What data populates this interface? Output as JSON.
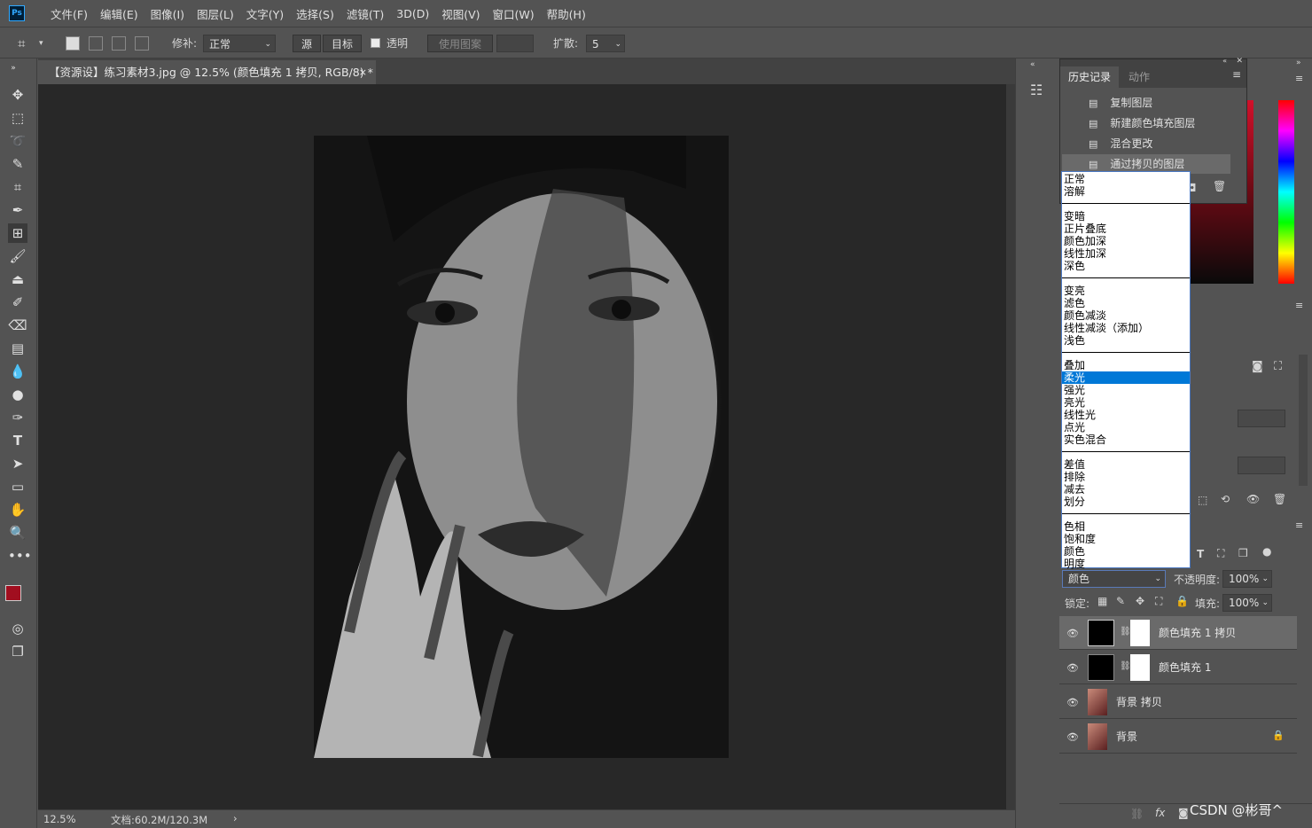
{
  "app": {
    "logo": "Ps"
  },
  "menu": [
    "文件(F)",
    "编辑(E)",
    "图像(I)",
    "图层(L)",
    "文字(Y)",
    "选择(S)",
    "滤镜(T)",
    "3D(D)",
    "视图(V)",
    "窗口(W)",
    "帮助(H)"
  ],
  "options": {
    "patch_label": "修补:",
    "patch_mode": "正常",
    "source_btn": "源",
    "target_btn": "目标",
    "transparent_label": "透明",
    "use_pattern_btn": "使用图案",
    "diffusion_label": "扩散:",
    "diffusion_value": "5"
  },
  "document": {
    "tab_title": "【资源设】练习素材3.jpg @ 12.5% (颜色填充 1 拷贝, RGB/8) *",
    "close": "×",
    "zoom": "12.5%",
    "doc_size": "文档:60.2M/120.3M",
    "status_arrow": "›"
  },
  "history": {
    "tabs": [
      "历史记录",
      "动作"
    ],
    "items": [
      "复制图层",
      "新建颜色填充图层",
      "混合更改",
      "通过拷贝的图层"
    ]
  },
  "blend_modes": {
    "groups": [
      [
        "正常",
        "溶解"
      ],
      [
        "变暗",
        "正片叠底",
        "颜色加深",
        "线性加深",
        "深色"
      ],
      [
        "变亮",
        "滤色",
        "颜色减淡",
        "线性减淡（添加）",
        "浅色"
      ],
      [
        "叠加",
        "柔光",
        "强光",
        "亮光",
        "线性光",
        "点光",
        "实色混合"
      ],
      [
        "差值",
        "排除",
        "减去",
        "划分"
      ],
      [
        "色相",
        "饱和度",
        "颜色",
        "明度"
      ]
    ],
    "highlighted": "柔光"
  },
  "layers": {
    "blend_mode": "颜色",
    "opacity_label": "不透明度:",
    "opacity": "100%",
    "lock_label": "锁定:",
    "fill_label": "填充:",
    "fill": "100%",
    "items": [
      {
        "name": "颜色填充 1 拷贝",
        "type": "fill"
      },
      {
        "name": "颜色填充 1",
        "type": "fill"
      },
      {
        "name": "背景 拷贝",
        "type": "photo"
      },
      {
        "name": "背景",
        "type": "photo"
      }
    ],
    "footer_fx": "fx"
  },
  "watermark": "CSDN @彬哥^",
  "colors": {
    "foreground": "#a10e1f",
    "background": "#ffffff",
    "highlight": "#0078d7"
  }
}
